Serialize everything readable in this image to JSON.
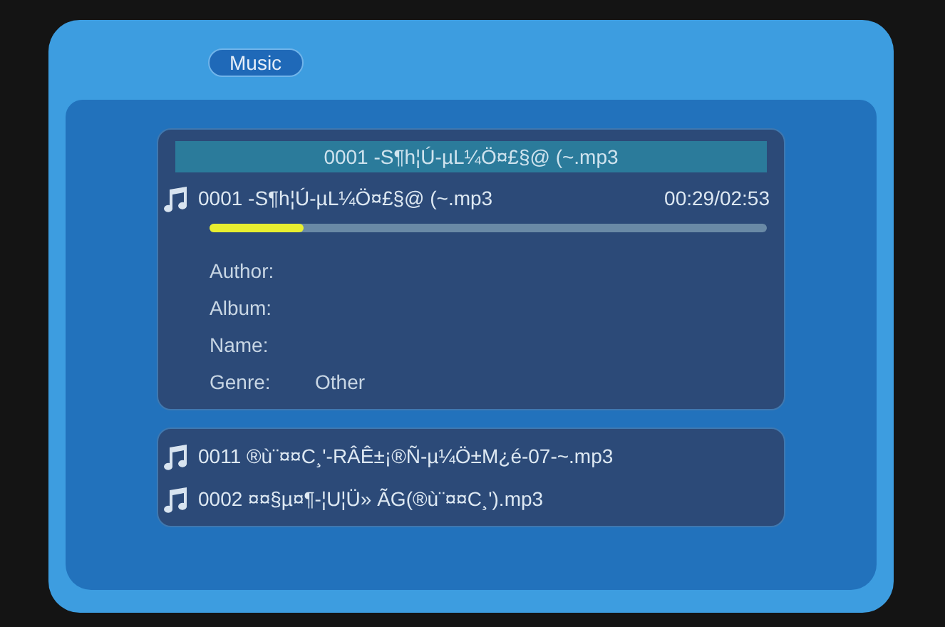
{
  "header": {
    "title": "Music"
  },
  "now_playing": {
    "title_bar": "0001  -S¶h¦Ú-µL¼Ö¤£§@ (~.mp3",
    "track": "0001  -S¶h¦Ú-µL¼Ö¤£§@ (~.mp3",
    "time": "00:29/02:53",
    "level": 0.17
  },
  "info": [
    {
      "label": "Author:"
    },
    {
      "label": "Album:"
    },
    {
      "label": "Name:"
    },
    {
      "label": "Genre:",
      "value": "Other"
    }
  ],
  "playlist": [
    {
      "text": "0011  ®ù¨¤¤C¸'-RÂÊ±¡®Ñ-µ¼Ö±M¿é-07-~.mp3"
    },
    {
      "text": "0002  ¤¤§µ¤¶-¦U¦Ü» ÃG(®ù¨¤¤C¸').mp3"
    }
  ]
}
